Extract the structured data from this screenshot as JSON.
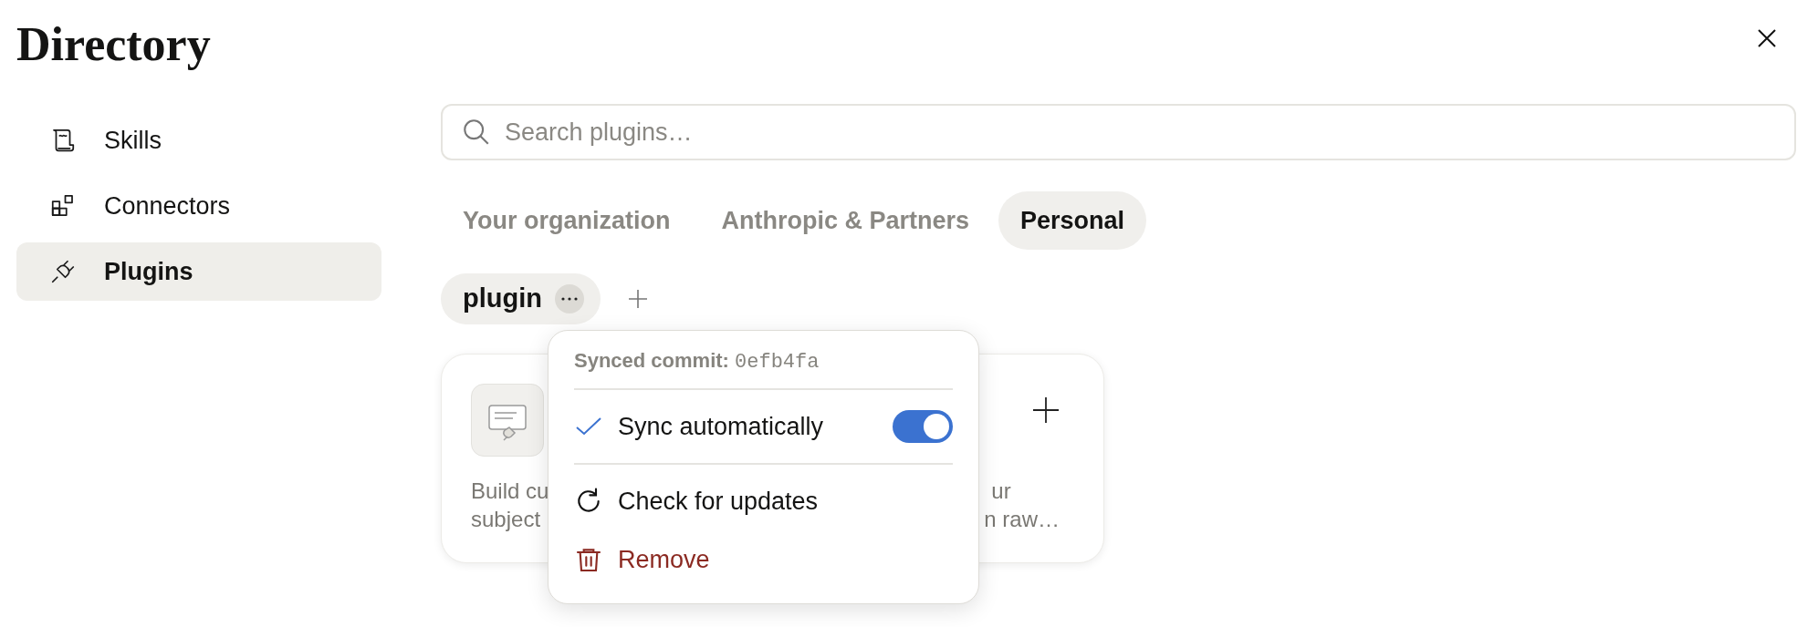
{
  "title": "Directory",
  "sidebar": {
    "items": [
      {
        "label": "Skills",
        "kind": "skills",
        "selected": false
      },
      {
        "label": "Connectors",
        "kind": "connectors",
        "selected": false
      },
      {
        "label": "Plugins",
        "kind": "plugins",
        "selected": true
      }
    ]
  },
  "search": {
    "placeholder": "Search plugins…"
  },
  "tabs": [
    {
      "label": "Your organization",
      "selected": false
    },
    {
      "label": "Anthropic & Partners",
      "selected": false
    },
    {
      "label": "Personal",
      "selected": true
    }
  ],
  "chips": [
    {
      "label": "plugin",
      "selected": true
    }
  ],
  "cards": [
    {
      "kind": "plugin",
      "description": [
        "Build cu",
        "subject"
      ]
    },
    {
      "kind": "create",
      "description": [
        "ur",
        "n raw…"
      ]
    }
  ],
  "menu": {
    "header_label": "Synced commit:",
    "commit": "0efb4fa",
    "items": [
      {
        "kind": "toggle",
        "label": "Sync automatically",
        "checked": true,
        "on": true
      },
      {
        "kind": "refresh",
        "label": "Check for updates"
      },
      {
        "kind": "danger",
        "label": "Remove"
      }
    ]
  }
}
